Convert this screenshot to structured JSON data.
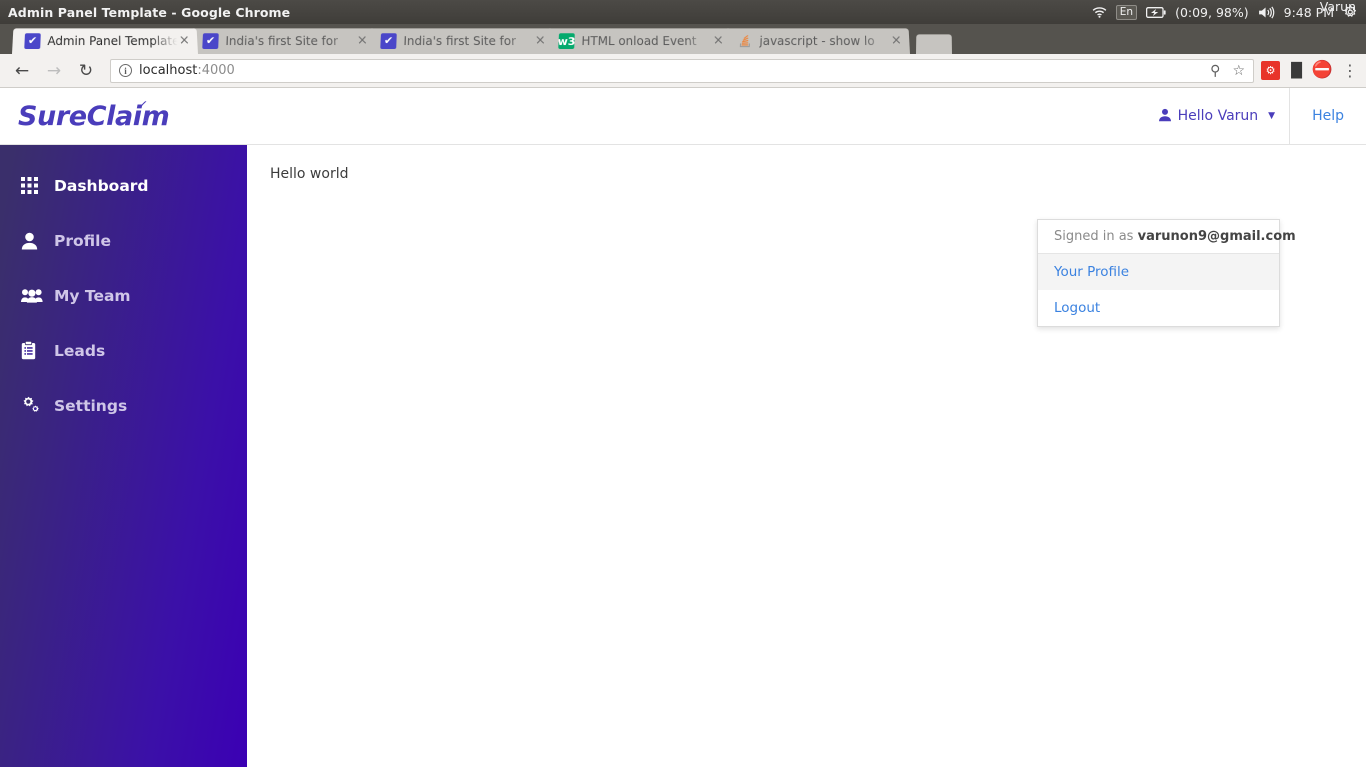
{
  "os_bar": {
    "window_title": "Admin Panel Template - Google Chrome",
    "wifi_icon": "wifi-icon",
    "keyboard_layout": "En",
    "battery_icon": "battery-charging-icon",
    "battery_status": "(0:09, 98%)",
    "volume_icon": "volume-icon",
    "clock": "9:48 PM",
    "settings_icon": "gear-icon",
    "user_name": "Varun"
  },
  "browser": {
    "tabs": [
      {
        "title": "Admin Panel Template",
        "favicon": "blue-checkmark-favicon",
        "active": true,
        "close": "×"
      },
      {
        "title": "India's first Site for",
        "favicon": "blue-checkmark-favicon",
        "active": false,
        "close": "×"
      },
      {
        "title": "India's first Site for",
        "favicon": "blue-checkmark-favicon",
        "active": false,
        "close": "×"
      },
      {
        "title": "HTML onload Event",
        "favicon": "w3schools-favicon",
        "active": false,
        "close": "×"
      },
      {
        "title": "javascript - show lo",
        "favicon": "stackoverflow-favicon",
        "active": false,
        "close": "×"
      }
    ],
    "toolbar": {
      "back_icon": "back-arrow-icon",
      "forward_icon": "forward-arrow-icon",
      "reload_icon": "reload-icon",
      "info_icon": "info-circle-icon",
      "url_host": "localhost",
      "url_rest": ":4000",
      "key_icon": "key-icon",
      "bookmark_icon": "star-icon",
      "extension_red_icon": "extension-icon",
      "extension_dark_icon": "extension-icon",
      "extension_opera_icon": "adblock-shield-icon",
      "menu_icon": "three-dots-menu-icon"
    }
  },
  "app": {
    "brand": "SureClaim",
    "brand_tick": "✓",
    "header": {
      "user_greeting": "Hello Varun",
      "user_icon": "person-icon",
      "caret_icon": "chevron-down-icon",
      "help_label": "Help"
    },
    "dropdown": {
      "signed_in_prefix": "Signed in as",
      "signed_in_email": "varunon9@gmail.com",
      "items": [
        {
          "label": "Your Profile",
          "highlighted": true
        },
        {
          "label": "Logout",
          "highlighted": false
        }
      ]
    },
    "sidebar": {
      "items": [
        {
          "label": "Dashboard",
          "icon": "grid-icon",
          "active": true
        },
        {
          "label": "Profile",
          "icon": "person-icon",
          "active": false
        },
        {
          "label": "My Team",
          "icon": "people-icon",
          "active": false
        },
        {
          "label": "Leads",
          "icon": "clipboard-icon",
          "active": false
        },
        {
          "label": "Settings",
          "icon": "gears-icon",
          "active": false
        }
      ]
    },
    "content": {
      "body_text": "Hello world"
    },
    "colors": {
      "brand_purple": "#4a3dbb",
      "sidebar_from": "#3a2f6b",
      "sidebar_to": "#3b00b4",
      "link_blue": "#3b82e0"
    }
  }
}
